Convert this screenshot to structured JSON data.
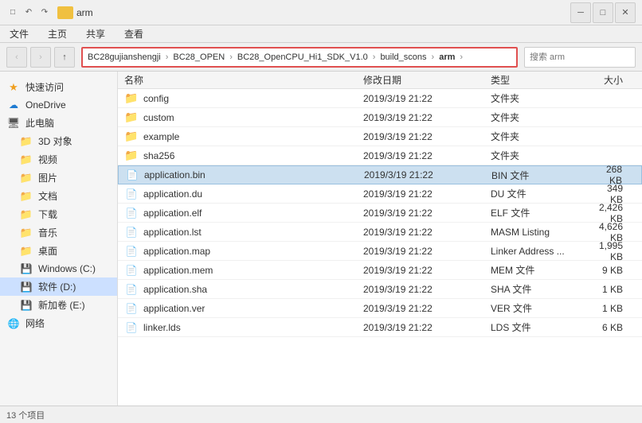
{
  "titleBar": {
    "title": "arm",
    "icons": [
      "─",
      "□",
      "✕"
    ]
  },
  "menuBar": {
    "items": [
      "文件",
      "主页",
      "共享",
      "查看"
    ]
  },
  "toolbar": {
    "back": "‹",
    "forward": "›",
    "up": "↑"
  },
  "addressBar": {
    "crumbs": [
      {
        "label": "BC28gujianshengji",
        "active": false
      },
      {
        "label": "BC28_OPEN",
        "active": false
      },
      {
        "label": "BC28_OpenCPU_Hi1_SDK_V1.0",
        "active": false
      },
      {
        "label": "build_scons",
        "active": false
      },
      {
        "label": "arm",
        "active": true
      }
    ],
    "searchPlaceholder": "搜索"
  },
  "sidebar": {
    "sections": [
      {
        "items": [
          {
            "label": "快速访问",
            "icon": "star",
            "indent": 0
          },
          {
            "label": "OneDrive",
            "icon": "cloud",
            "indent": 0
          },
          {
            "label": "此电脑",
            "icon": "pc",
            "indent": 0
          },
          {
            "label": "3D 对象",
            "icon": "folder",
            "indent": 1
          },
          {
            "label": "视频",
            "icon": "folder",
            "indent": 1
          },
          {
            "label": "图片",
            "icon": "folder",
            "indent": 1
          },
          {
            "label": "文档",
            "icon": "folder",
            "indent": 1
          },
          {
            "label": "下载",
            "icon": "folder",
            "indent": 1
          },
          {
            "label": "音乐",
            "icon": "folder",
            "indent": 1
          },
          {
            "label": "桌面",
            "icon": "folder",
            "indent": 1
          },
          {
            "label": "Windows (C:)",
            "icon": "drive",
            "indent": 1
          },
          {
            "label": "软件 (D:)",
            "icon": "drive",
            "indent": 1,
            "selected": true
          },
          {
            "label": "新加卷 (E:)",
            "icon": "drive",
            "indent": 1
          },
          {
            "label": "网络",
            "icon": "network",
            "indent": 0
          }
        ]
      }
    ]
  },
  "fileList": {
    "headers": {
      "name": "名称",
      "date": "修改日期",
      "type": "类型",
      "size": "大小"
    },
    "rows": [
      {
        "name": "config",
        "date": "2019/3/19 21:22",
        "type": "文件夹",
        "size": "",
        "icon": "folder",
        "selected": false
      },
      {
        "name": "custom",
        "date": "2019/3/19 21:22",
        "type": "文件夹",
        "size": "",
        "icon": "folder",
        "selected": false
      },
      {
        "name": "example",
        "date": "2019/3/19 21:22",
        "type": "文件夹",
        "size": "",
        "icon": "folder",
        "selected": false
      },
      {
        "name": "sha256",
        "date": "2019/3/19 21:22",
        "type": "文件夹",
        "size": "",
        "icon": "folder",
        "selected": false
      },
      {
        "name": "application.bin",
        "date": "2019/3/19 21:22",
        "type": "BIN 文件",
        "size": "268 KB",
        "icon": "file",
        "selected": true
      },
      {
        "name": "application.du",
        "date": "2019/3/19 21:22",
        "type": "DU 文件",
        "size": "349 KB",
        "icon": "file",
        "selected": false
      },
      {
        "name": "application.elf",
        "date": "2019/3/19 21:22",
        "type": "ELF 文件",
        "size": "2,426 KB",
        "icon": "file",
        "selected": false
      },
      {
        "name": "application.lst",
        "date": "2019/3/19 21:22",
        "type": "MASM Listing",
        "size": "4,626 KB",
        "icon": "doc",
        "selected": false
      },
      {
        "name": "application.map",
        "date": "2019/3/19 21:22",
        "type": "Linker Address ...",
        "size": "1,995 KB",
        "icon": "file",
        "selected": false
      },
      {
        "name": "application.mem",
        "date": "2019/3/19 21:22",
        "type": "MEM 文件",
        "size": "9 KB",
        "icon": "file",
        "selected": false
      },
      {
        "name": "application.sha",
        "date": "2019/3/19 21:22",
        "type": "SHA 文件",
        "size": "1 KB",
        "icon": "file",
        "selected": false
      },
      {
        "name": "application.ver",
        "date": "2019/3/19 21:22",
        "type": "VER 文件",
        "size": "1 KB",
        "icon": "file",
        "selected": false
      },
      {
        "name": "linker.lds",
        "date": "2019/3/19 21:22",
        "type": "LDS 文件",
        "size": "6 KB",
        "icon": "file",
        "selected": false
      }
    ]
  },
  "statusBar": {
    "text": "13 个项目"
  }
}
